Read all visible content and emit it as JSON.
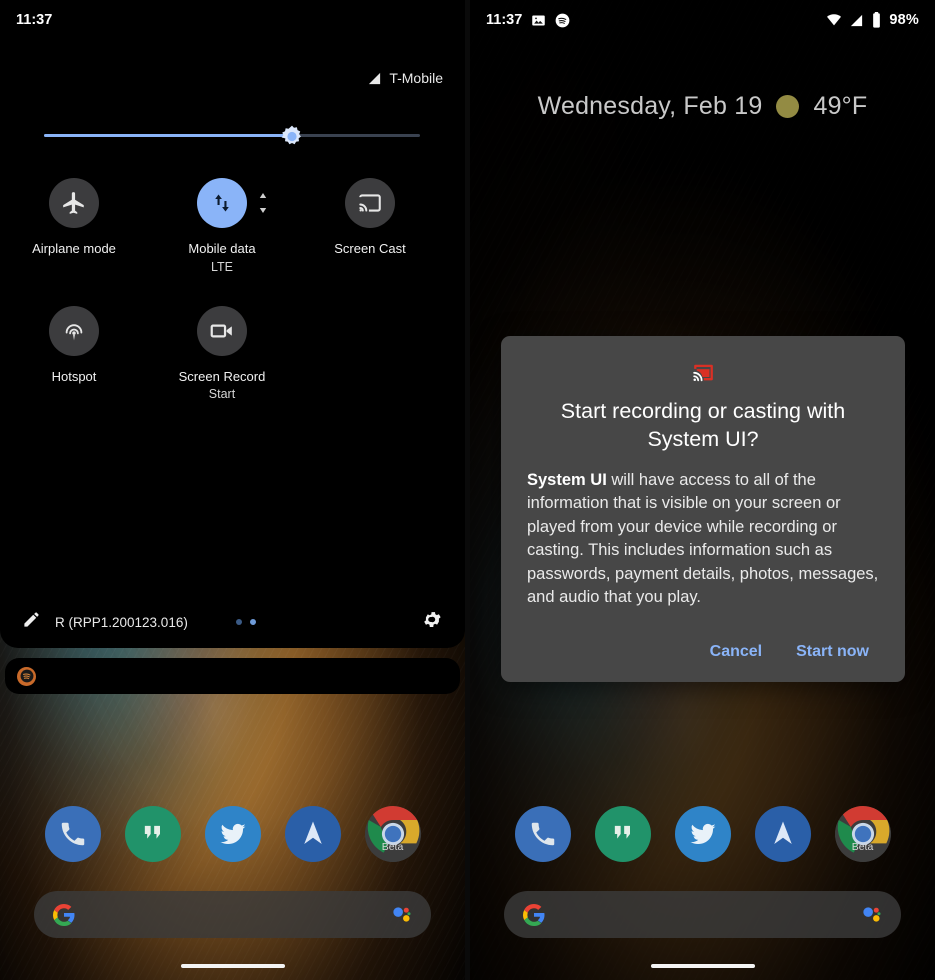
{
  "left_panel": {
    "status_bar": {
      "time": "11:37"
    },
    "quick_settings": {
      "carrier": {
        "label": "T-Mobile",
        "icon": "signal-icon"
      },
      "brightness": {
        "icon": "brightness-icon",
        "value_percent": 66
      },
      "tiles": [
        {
          "label": "Airplane mode",
          "sublabel": "",
          "icon": "airplane-icon",
          "active": false,
          "expandable": false
        },
        {
          "label": "Mobile data",
          "sublabel": "LTE",
          "icon": "mobile-data-icon",
          "active": true,
          "expandable": true
        },
        {
          "label": "Screen Cast",
          "sublabel": "",
          "icon": "cast-icon",
          "active": false,
          "expandable": false
        },
        {
          "label": "Hotspot",
          "sublabel": "",
          "icon": "hotspot-icon",
          "active": false,
          "expandable": false
        },
        {
          "label": "Screen Record",
          "sublabel": "Start",
          "icon": "videocam-icon",
          "active": false,
          "expandable": false
        }
      ],
      "footer": {
        "edit_icon": "pencil-icon",
        "build_label": "R (RPP1.200123.016)",
        "page_dots": 2,
        "active_dot": 2,
        "settings_icon": "gear-icon"
      }
    },
    "notification": {
      "app_icon": "spotify-icon"
    },
    "home": {
      "dock": [
        {
          "name": "Phone",
          "icon": "phone-icon"
        },
        {
          "name": "Hangouts",
          "icon": "hangouts-icon"
        },
        {
          "name": "Twitter",
          "icon": "twitter-icon"
        },
        {
          "name": "Spark",
          "icon": "paper-plane-icon"
        },
        {
          "name": "Chrome Beta",
          "icon": "chrome-icon",
          "badge": "Beta"
        }
      ],
      "search": {
        "logo": "google-g-icon",
        "assistant": "assistant-icon",
        "placeholder": ""
      }
    }
  },
  "right_panel": {
    "status_bar": {
      "time": "11:37",
      "left_icons": [
        "image-icon",
        "spotify-icon"
      ],
      "right_icons": [
        "wifi-icon",
        "signal-icon",
        "battery-icon"
      ],
      "battery_percent": "98%"
    },
    "header": {
      "date": "Wednesday, Feb 19",
      "weather_icon": "sun-icon",
      "temperature": "49°F"
    },
    "dialog": {
      "icon": "cast-icon",
      "title": "Start recording or casting with System UI?",
      "body_strong": "System UI",
      "body_rest": " will have access to all of the information that is visible on your screen or played from your device while recording or casting. This includes information such as passwords, payment details, photos, messages, and audio that you play.",
      "cancel_label": "Cancel",
      "confirm_label": "Start now"
    },
    "home": {
      "dock": [
        {
          "name": "Phone",
          "icon": "phone-icon"
        },
        {
          "name": "Hangouts",
          "icon": "hangouts-icon"
        },
        {
          "name": "Twitter",
          "icon": "twitter-icon"
        },
        {
          "name": "Spark",
          "icon": "paper-plane-icon"
        },
        {
          "name": "Chrome Beta",
          "icon": "chrome-icon",
          "badge": "Beta"
        }
      ],
      "search": {
        "logo": "google-g-icon",
        "assistant": "assistant-icon",
        "placeholder": ""
      }
    }
  },
  "colors": {
    "accent_blue": "#8ab4f8",
    "dialog_bg": "#474747",
    "shade_bg": "#000000",
    "tile_inactive": "#3c3c3e",
    "cast_red": "#d93025"
  }
}
